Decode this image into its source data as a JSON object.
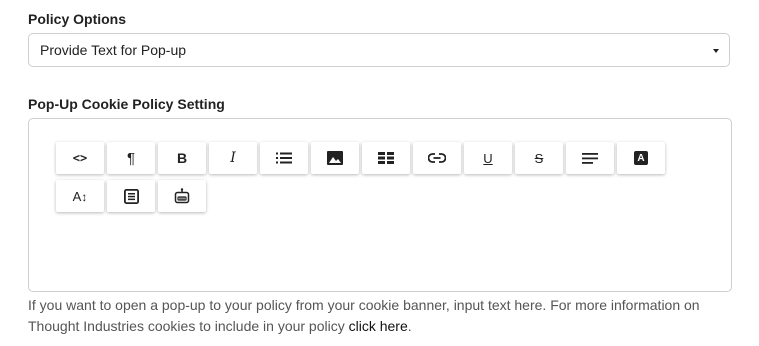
{
  "policy_options": {
    "label": "Policy Options",
    "selected": "Provide Text for Pop-up"
  },
  "popup_setting": {
    "label": "Pop-Up Cookie Policy Setting"
  },
  "toolbar": {
    "buttons": [
      {
        "name": "code-view-button",
        "icon": "code-icon",
        "glyph": "<>"
      },
      {
        "name": "paragraph-button",
        "icon": "pilcrow-icon",
        "glyph": "¶"
      },
      {
        "name": "bold-button",
        "icon": "bold-icon",
        "glyph": "B"
      },
      {
        "name": "italic-button",
        "icon": "italic-icon",
        "glyph": "I"
      },
      {
        "name": "bulleted-list-button",
        "icon": "list-icon",
        "glyph": ""
      },
      {
        "name": "insert-image-button",
        "icon": "image-icon",
        "glyph": ""
      },
      {
        "name": "insert-table-button",
        "icon": "table-icon",
        "glyph": ""
      },
      {
        "name": "insert-link-button",
        "icon": "link-icon",
        "glyph": ""
      },
      {
        "name": "underline-button",
        "icon": "underline-icon",
        "glyph": "U"
      },
      {
        "name": "strikethrough-button",
        "icon": "strikethrough-icon",
        "glyph": "S"
      },
      {
        "name": "align-button",
        "icon": "align-left-icon",
        "glyph": ""
      },
      {
        "name": "text-color-button",
        "icon": "text-color-icon",
        "glyph": "A"
      },
      {
        "name": "font-size-button",
        "icon": "font-size-icon",
        "glyph": "A"
      },
      {
        "name": "blocks-button",
        "icon": "document-icon",
        "glyph": ""
      },
      {
        "name": "embed-button",
        "icon": "robot-icon",
        "glyph": ""
      }
    ]
  },
  "help": {
    "text": "If you want to open a pop-up to your policy from your cookie banner, input text here. For more information on Thought Industries cookies to include in your policy ",
    "link_text": "click here",
    "trailing": "."
  }
}
